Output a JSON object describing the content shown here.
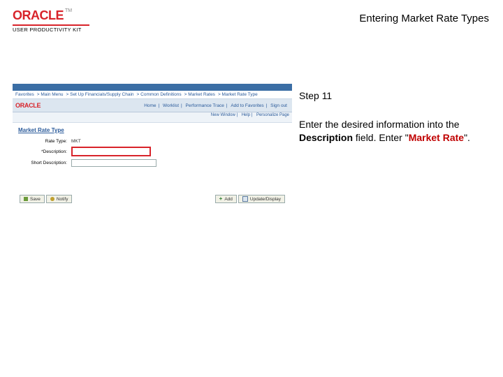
{
  "header": {
    "brand": "ORACLE",
    "subbrand": "USER PRODUCTIVITY KIT",
    "tm": "TM"
  },
  "title": "Entering Market Rate Types",
  "instruction": {
    "step_label": "Step 11",
    "pre": "Enter the desired information into the ",
    "field_name": "Description",
    "mid": " field. Enter \"",
    "value": "Market Rate",
    "post": "\"."
  },
  "screenshot": {
    "crumbs_left": [
      "Favorites",
      "Main Menu",
      "Set Up Financials/Supply Chain",
      "Common Definitions",
      "Market Rates",
      "Market Rate Type"
    ],
    "crumbs_right": "",
    "navlinks": [
      "Home",
      "Worklist",
      "Performance Trace",
      "Add to Favorites",
      "Sign out"
    ],
    "subbar_links": [
      "New Window",
      "Help",
      "Personalize Page"
    ],
    "section_heading": "Market Rate Type",
    "rows": {
      "rate_type_label": "Rate Type:",
      "rate_type_value": "MKT",
      "description_label": "*Description:",
      "short_desc_label": "Short Description:"
    },
    "buttons": {
      "save": "Save",
      "notify": "Notify",
      "add": "Add",
      "update": "Update/Display"
    }
  }
}
